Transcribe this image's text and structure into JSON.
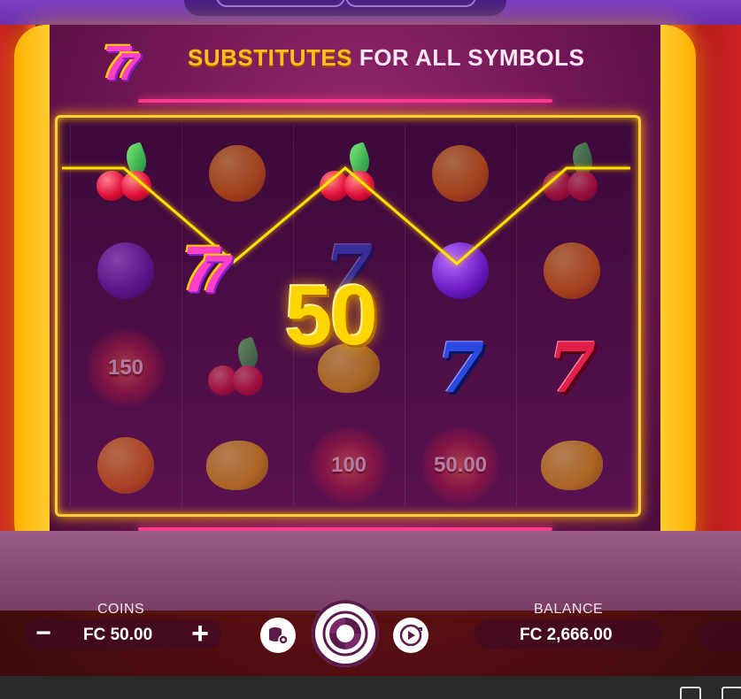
{
  "banner": {
    "symbol": "7/7",
    "text_highlight": "SUBSTITUTES",
    "text_rest": "FOR ALL SYMBOLS"
  },
  "reels": [
    [
      "cherry",
      "plum",
      "coin:150",
      "orange"
    ],
    [
      "orange",
      "seven-wild",
      "cherry",
      "lemon"
    ],
    [
      "cherry",
      "seven-blue",
      "lemon",
      "coin:100"
    ],
    [
      "orange",
      "plum",
      "seven-blue",
      "coin:50.00"
    ],
    [
      "cherry",
      "orange",
      "seven-red",
      "lemon"
    ]
  ],
  "coins_on_reels": {
    "reel1": "150",
    "reel3": "100",
    "reel4": "50.00"
  },
  "win_amount": "50",
  "controls": {
    "coins_label": "COINS",
    "coins_value": "FC 50.00",
    "minus_symbol": "−",
    "plus_symbol": "+",
    "balance_label": "BALANCE",
    "balance_value": "FC 2,666.00"
  },
  "icons": {
    "coin_settings": "coin-stack-settings-icon",
    "spin": "spin-icon",
    "autoplay": "autoplay-icon",
    "camera": "camera-icon",
    "gallery": "image-icon"
  },
  "colors": {
    "accent_gold": "#ffd23a",
    "neon_pink": "#ff3b8d",
    "payline": "#ffe600"
  }
}
